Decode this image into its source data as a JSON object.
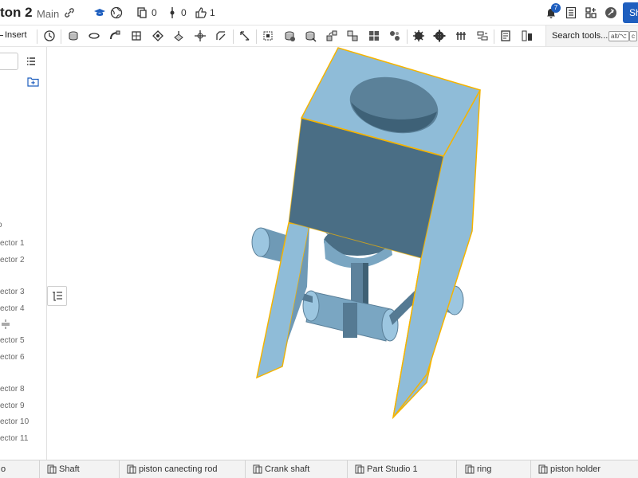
{
  "header": {
    "doc_title": "ton 2",
    "branch": "Main",
    "counts": {
      "copies": "0",
      "versions": "0",
      "likes": "1"
    },
    "notifications": "7",
    "share_label": "Sh"
  },
  "toolbar": {
    "insert_label": "Insert",
    "search_label": "Search tools...",
    "shortcut_keys": [
      "alt/⌥",
      "c"
    ]
  },
  "featurelist": {
    "items": [
      "o",
      "ector 1",
      "ector 2",
      "ector 3",
      "ector 4",
      "ector 5",
      "ector 6",
      "ector 8",
      "ector 9",
      "ector 10",
      "ector 11"
    ]
  },
  "tabs": [
    {
      "label": "o"
    },
    {
      "label": "Shaft"
    },
    {
      "label": "piston canecting rod"
    },
    {
      "label": "Crank shaft"
    },
    {
      "label": "Part Studio 1"
    },
    {
      "label": "ring"
    },
    {
      "label": "piston holder"
    }
  ],
  "colors": {
    "part_face": "#8fbcd8",
    "part_dark": "#4a6e85",
    "part_mid": "#7aa6c2",
    "selection": "#f5b400",
    "accent": "#1f5fbf"
  }
}
